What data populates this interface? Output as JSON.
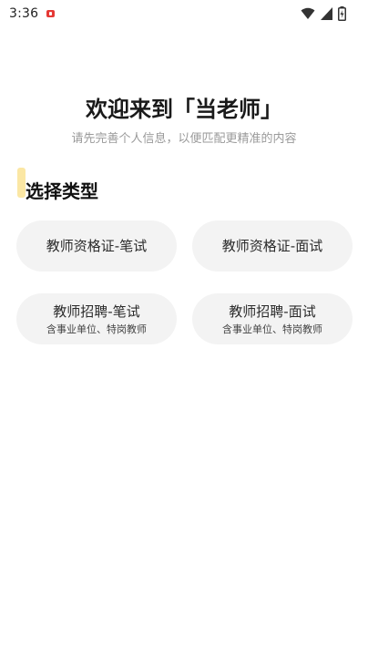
{
  "status_bar": {
    "time": "3:36",
    "icons": [
      "notification-icon",
      "wifi-icon",
      "signal-icon",
      "battery-icon"
    ]
  },
  "welcome": {
    "title": "欢迎来到「当老师」",
    "subtitle": "请先完善个人信息，以便匹配更精准的内容"
  },
  "section": {
    "heading": "选择类型"
  },
  "options": [
    {
      "title": "教师资格证-笔试",
      "subtitle": ""
    },
    {
      "title": "教师资格证-面试",
      "subtitle": ""
    },
    {
      "title": "教师招聘-笔试",
      "subtitle": "含事业单位、特岗教师"
    },
    {
      "title": "教师招聘-面试",
      "subtitle": "含事业单位、特岗教师"
    }
  ],
  "colors": {
    "card_background": "#f3f3f3",
    "accent": "#fbe7a4",
    "subtitle_text": "#9a9a9a",
    "notification": "#e53935"
  }
}
